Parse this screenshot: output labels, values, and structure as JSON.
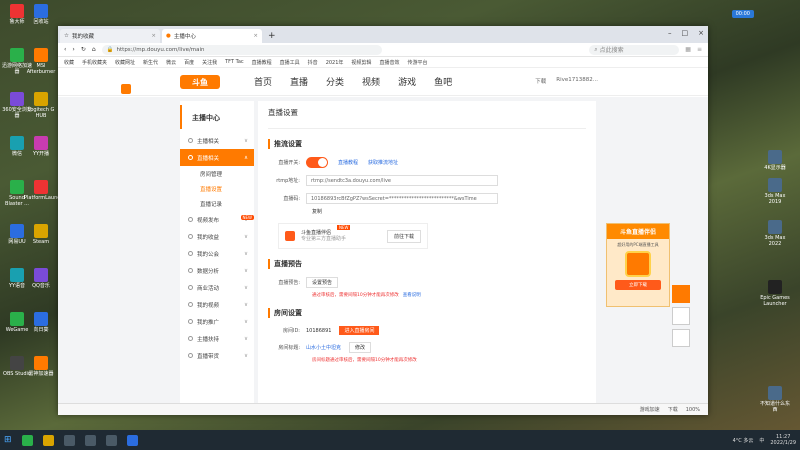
{
  "desktop": {
    "left_icons": [
      "鲁大师",
      "回收站",
      "迅游网络加速器",
      "MSI Afterburner",
      "360安全浏览器",
      "Logitech G HUB",
      "微信",
      "YY开播",
      "Sound Blaster ...",
      "PlatformLauncher",
      "网易UU",
      "Steam",
      "YY语音",
      "QQ音乐",
      "WeGame",
      "向日葵",
      "OBS Studio",
      "雷神加速器"
    ],
    "right_icons": [
      "4K显示器",
      "3ds Max 2019",
      "3ds Max 2022",
      "Epic Games Launcher",
      "不知道什么东西"
    ],
    "top_right_badge": "00:00"
  },
  "browser": {
    "tabs": [
      {
        "label": "我的收藏"
      },
      {
        "label": "主播中心"
      }
    ],
    "url": "https://mp.douyu.com/live/main",
    "search_placeholder": "点此搜索",
    "bookmarks": [
      "收藏",
      "手机收藏夹",
      "收藏网址",
      "新生代",
      "微云",
      "百度",
      "关注我",
      "TFT Tac",
      "直播教程",
      "直播工具",
      "抖音",
      "2021年",
      "视频剪辑",
      "直播音效",
      "传游平台"
    ]
  },
  "site": {
    "logo": "斗鱼",
    "nav": [
      "首页",
      "直播",
      "分类",
      "视频",
      "游戏",
      "鱼吧"
    ],
    "nav_right": [
      "下载",
      "Rive1713882..."
    ]
  },
  "sidebar": {
    "title": "主播中心",
    "items": [
      {
        "label": "主播相关"
      },
      {
        "label": "直播相关",
        "active": true
      },
      {
        "label": "房间管理",
        "sub": true
      },
      {
        "label": "直播设置",
        "sub": true,
        "selected": true
      },
      {
        "label": "直播记录",
        "sub": true
      },
      {
        "label": "视频发布",
        "badge": "NEW"
      },
      {
        "label": "我的收益"
      },
      {
        "label": "我的公会"
      },
      {
        "label": "数据分析"
      },
      {
        "label": "商业活动"
      },
      {
        "label": "我的视频"
      },
      {
        "label": "我的推广"
      },
      {
        "label": "主播扶持"
      },
      {
        "label": "直播带货"
      }
    ]
  },
  "main": {
    "page_title": "直播设置",
    "push": {
      "heading": "推流设置",
      "switch_label": "直播开关:",
      "tutorial_link": "直播教程",
      "get_addr_link": "获取推流地址",
      "rtmp_label": "rtmp地址:",
      "rtmp_value": "rtmp://sendtc3a.douyu.com/live",
      "code_label": "直播码:",
      "code_value": "10186893rcBfZgPZ?wsSecret=**************************&wsTime",
      "copy_label": "复制",
      "promo_title": "斗鱼直播伴侣",
      "promo_sub": "专业第三方直播助手",
      "promo_badge": "NEW",
      "promo_button": "前往下载"
    },
    "preview": {
      "heading": "直播预告",
      "label": "直播预告:",
      "button": "设置预告",
      "note": "通过审核后，需要间隔10分钟才能再次修改",
      "note_link": "查看说明"
    },
    "room": {
      "heading": "房间设置",
      "id_label": "房间ID:",
      "id_value": "10186891",
      "enter_button": "进入直播房间",
      "title_label": "房间标题:",
      "title_value": "山水小土中坦克",
      "edit_button": "修改",
      "note": "房间标题通过审核后，需要间隔10分钟才能再次修改"
    }
  },
  "float_ad": {
    "title": "斗鱼直播伴侣",
    "sub": "超好用的PC端直播工具",
    "button": "立即下载"
  },
  "statusbar": [
    "游戏加速",
    "下载",
    "100%"
  ],
  "taskbar": {
    "weather": "4°C 多云",
    "ime": "中",
    "time": "11:27",
    "date": "2022/1/29"
  }
}
